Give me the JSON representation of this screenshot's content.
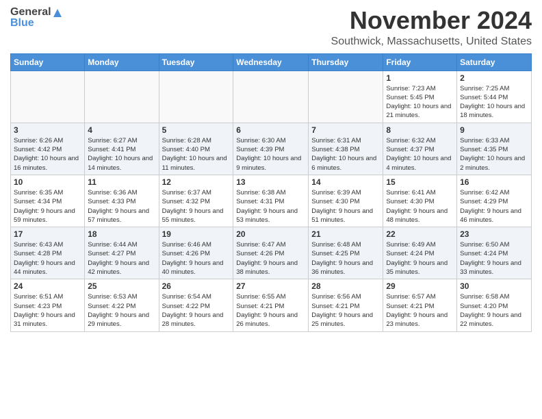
{
  "header": {
    "logo_general": "General",
    "logo_blue": "Blue",
    "month_title": "November 2024",
    "location": "Southwick, Massachusetts, United States"
  },
  "weekdays": [
    "Sunday",
    "Monday",
    "Tuesday",
    "Wednesday",
    "Thursday",
    "Friday",
    "Saturday"
  ],
  "weeks": [
    [
      {
        "day": "",
        "info": ""
      },
      {
        "day": "",
        "info": ""
      },
      {
        "day": "",
        "info": ""
      },
      {
        "day": "",
        "info": ""
      },
      {
        "day": "",
        "info": ""
      },
      {
        "day": "1",
        "info": "Sunrise: 7:23 AM\nSunset: 5:45 PM\nDaylight: 10 hours and 21 minutes."
      },
      {
        "day": "2",
        "info": "Sunrise: 7:25 AM\nSunset: 5:44 PM\nDaylight: 10 hours and 18 minutes."
      }
    ],
    [
      {
        "day": "3",
        "info": "Sunrise: 6:26 AM\nSunset: 4:42 PM\nDaylight: 10 hours and 16 minutes."
      },
      {
        "day": "4",
        "info": "Sunrise: 6:27 AM\nSunset: 4:41 PM\nDaylight: 10 hours and 14 minutes."
      },
      {
        "day": "5",
        "info": "Sunrise: 6:28 AM\nSunset: 4:40 PM\nDaylight: 10 hours and 11 minutes."
      },
      {
        "day": "6",
        "info": "Sunrise: 6:30 AM\nSunset: 4:39 PM\nDaylight: 10 hours and 9 minutes."
      },
      {
        "day": "7",
        "info": "Sunrise: 6:31 AM\nSunset: 4:38 PM\nDaylight: 10 hours and 6 minutes."
      },
      {
        "day": "8",
        "info": "Sunrise: 6:32 AM\nSunset: 4:37 PM\nDaylight: 10 hours and 4 minutes."
      },
      {
        "day": "9",
        "info": "Sunrise: 6:33 AM\nSunset: 4:35 PM\nDaylight: 10 hours and 2 minutes."
      }
    ],
    [
      {
        "day": "10",
        "info": "Sunrise: 6:35 AM\nSunset: 4:34 PM\nDaylight: 9 hours and 59 minutes."
      },
      {
        "day": "11",
        "info": "Sunrise: 6:36 AM\nSunset: 4:33 PM\nDaylight: 9 hours and 57 minutes."
      },
      {
        "day": "12",
        "info": "Sunrise: 6:37 AM\nSunset: 4:32 PM\nDaylight: 9 hours and 55 minutes."
      },
      {
        "day": "13",
        "info": "Sunrise: 6:38 AM\nSunset: 4:31 PM\nDaylight: 9 hours and 53 minutes."
      },
      {
        "day": "14",
        "info": "Sunrise: 6:39 AM\nSunset: 4:30 PM\nDaylight: 9 hours and 51 minutes."
      },
      {
        "day": "15",
        "info": "Sunrise: 6:41 AM\nSunset: 4:30 PM\nDaylight: 9 hours and 48 minutes."
      },
      {
        "day": "16",
        "info": "Sunrise: 6:42 AM\nSunset: 4:29 PM\nDaylight: 9 hours and 46 minutes."
      }
    ],
    [
      {
        "day": "17",
        "info": "Sunrise: 6:43 AM\nSunset: 4:28 PM\nDaylight: 9 hours and 44 minutes."
      },
      {
        "day": "18",
        "info": "Sunrise: 6:44 AM\nSunset: 4:27 PM\nDaylight: 9 hours and 42 minutes."
      },
      {
        "day": "19",
        "info": "Sunrise: 6:46 AM\nSunset: 4:26 PM\nDaylight: 9 hours and 40 minutes."
      },
      {
        "day": "20",
        "info": "Sunrise: 6:47 AM\nSunset: 4:26 PM\nDaylight: 9 hours and 38 minutes."
      },
      {
        "day": "21",
        "info": "Sunrise: 6:48 AM\nSunset: 4:25 PM\nDaylight: 9 hours and 36 minutes."
      },
      {
        "day": "22",
        "info": "Sunrise: 6:49 AM\nSunset: 4:24 PM\nDaylight: 9 hours and 35 minutes."
      },
      {
        "day": "23",
        "info": "Sunrise: 6:50 AM\nSunset: 4:24 PM\nDaylight: 9 hours and 33 minutes."
      }
    ],
    [
      {
        "day": "24",
        "info": "Sunrise: 6:51 AM\nSunset: 4:23 PM\nDaylight: 9 hours and 31 minutes."
      },
      {
        "day": "25",
        "info": "Sunrise: 6:53 AM\nSunset: 4:22 PM\nDaylight: 9 hours and 29 minutes."
      },
      {
        "day": "26",
        "info": "Sunrise: 6:54 AM\nSunset: 4:22 PM\nDaylight: 9 hours and 28 minutes."
      },
      {
        "day": "27",
        "info": "Sunrise: 6:55 AM\nSunset: 4:21 PM\nDaylight: 9 hours and 26 minutes."
      },
      {
        "day": "28",
        "info": "Sunrise: 6:56 AM\nSunset: 4:21 PM\nDaylight: 9 hours and 25 minutes."
      },
      {
        "day": "29",
        "info": "Sunrise: 6:57 AM\nSunset: 4:21 PM\nDaylight: 9 hours and 23 minutes."
      },
      {
        "day": "30",
        "info": "Sunrise: 6:58 AM\nSunset: 4:20 PM\nDaylight: 9 hours and 22 minutes."
      }
    ]
  ]
}
